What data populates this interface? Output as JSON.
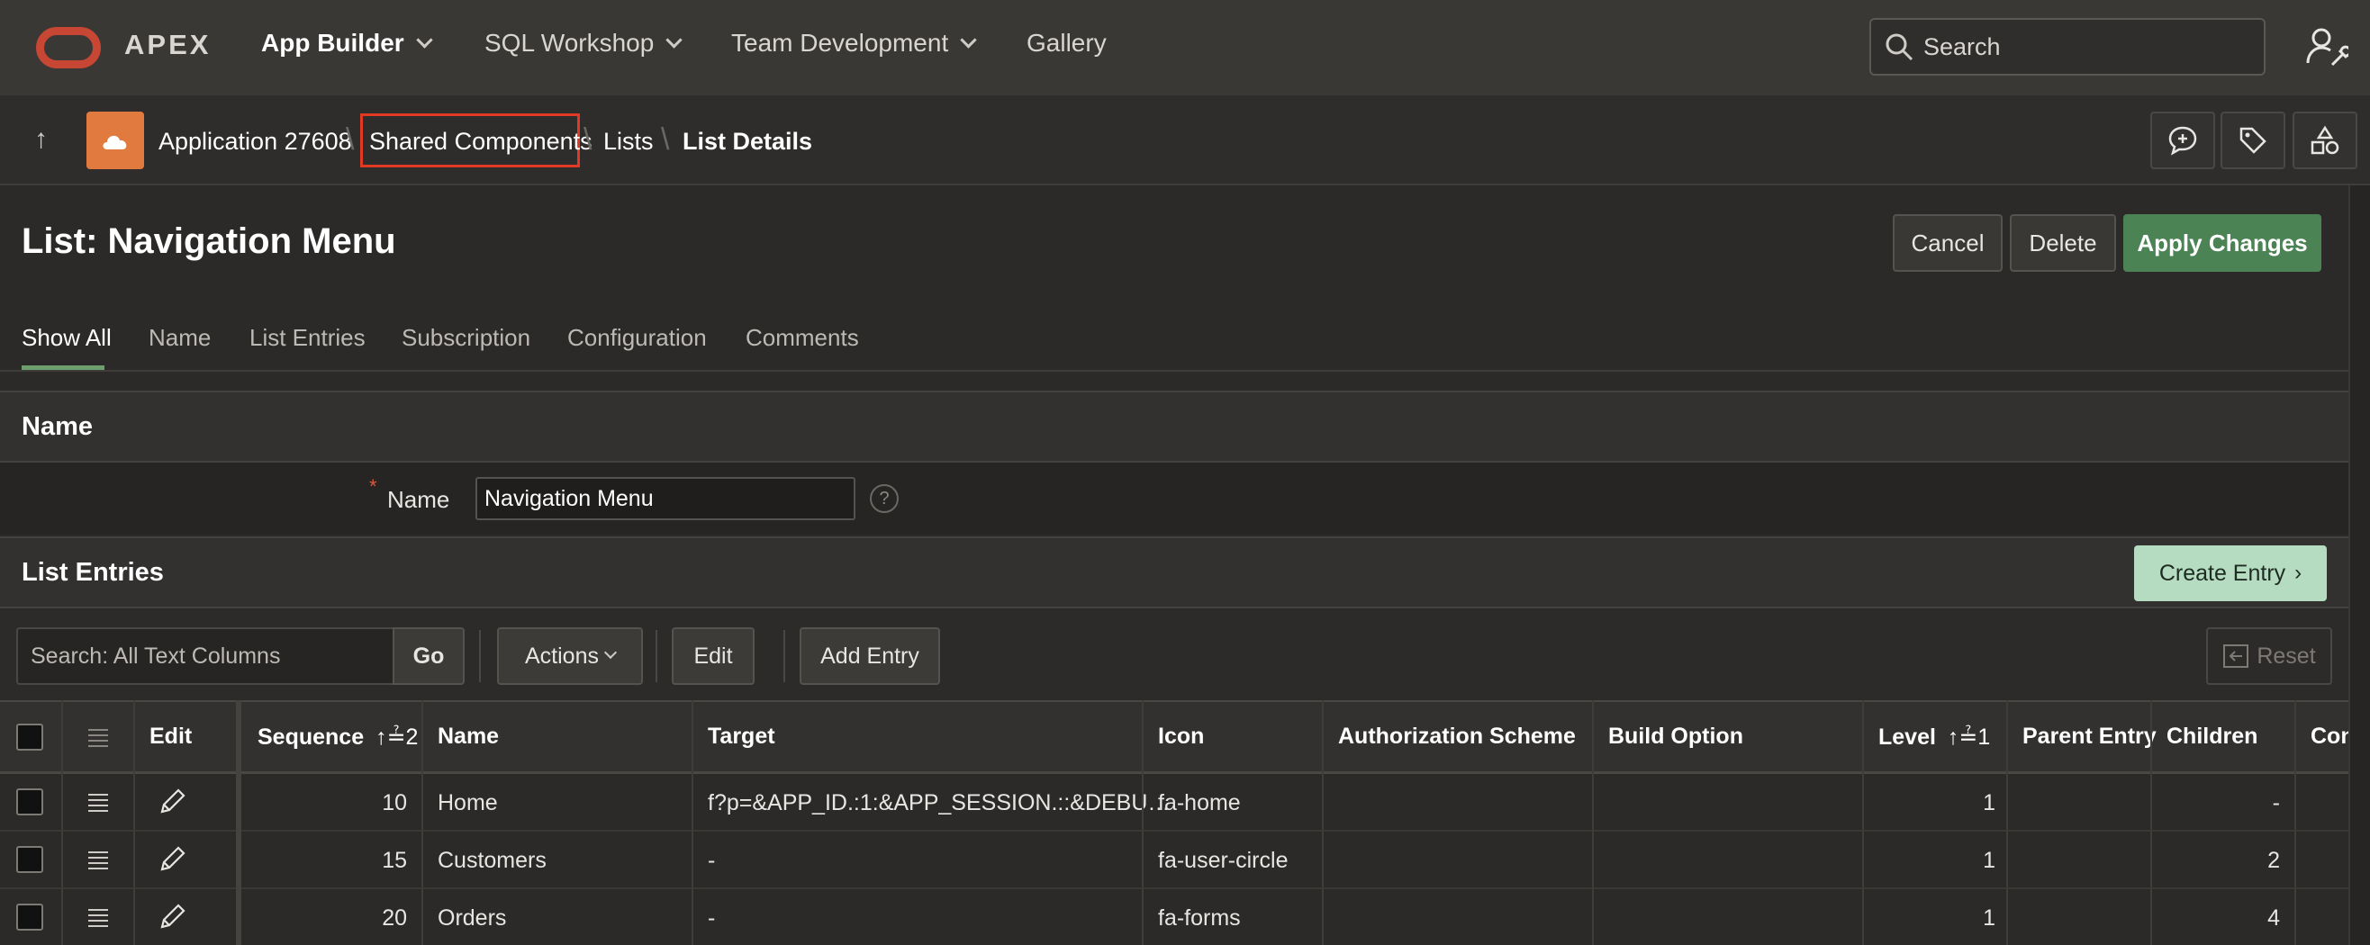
{
  "topnav": {
    "logo_text": "APEX",
    "items": [
      {
        "label": "App Builder"
      },
      {
        "label": "SQL Workshop"
      },
      {
        "label": "Team Development"
      },
      {
        "label": "Gallery"
      }
    ],
    "search_placeholder": "Search"
  },
  "breadcrumb": {
    "items": [
      "Application 27608",
      "Shared Components",
      "Lists",
      "List Details"
    ]
  },
  "page": {
    "title": "List: Navigation Menu",
    "buttons": {
      "cancel": "Cancel",
      "delete": "Delete",
      "apply": "Apply Changes"
    },
    "tabs": [
      "Show All",
      "Name",
      "List Entries",
      "Subscription",
      "Configuration",
      "Comments"
    ]
  },
  "name_section": {
    "title": "Name",
    "field_label": "Name",
    "field_value": "Navigation Menu",
    "required_mark": "*",
    "help": "?"
  },
  "entries_section": {
    "title": "List Entries",
    "create_label": "Create Entry"
  },
  "toolbar": {
    "search_placeholder": "Search: All Text Columns",
    "go": "Go",
    "actions": "Actions",
    "edit": "Edit",
    "add_entry": "Add Entry",
    "reset": "Reset"
  },
  "grid": {
    "columns": [
      "Edit",
      "Sequence",
      "Name",
      "Target",
      "Icon",
      "Authorization Scheme",
      "Build Option",
      "Level",
      "Parent Entry",
      "Children",
      "Con"
    ],
    "sort_badges": {
      "sequence": "↑≟2",
      "level": "↑≟1"
    },
    "rows": [
      {
        "sequence": "10",
        "name": "Home",
        "target": "f?p=&APP_ID.:1:&APP_SESSION.::&DEBU…",
        "icon": "fa-home",
        "auth": "",
        "build": "",
        "level": "1",
        "parent": "",
        "children": "-"
      },
      {
        "sequence": "15",
        "name": "Customers",
        "target": "-",
        "icon": "fa-user-circle",
        "auth": "",
        "build": "",
        "level": "1",
        "parent": "",
        "children": "2"
      },
      {
        "sequence": "20",
        "name": "Orders",
        "target": "-",
        "icon": "fa-forms",
        "auth": "",
        "build": "",
        "level": "1",
        "parent": "",
        "children": "4"
      }
    ]
  },
  "colors": {
    "oracle_red": "#c74634",
    "apply_green": "#4c8355",
    "create_mint": "#b5dcc1",
    "app_icon_orange": "#e07a3f",
    "highlight_red": "#e03a26"
  }
}
